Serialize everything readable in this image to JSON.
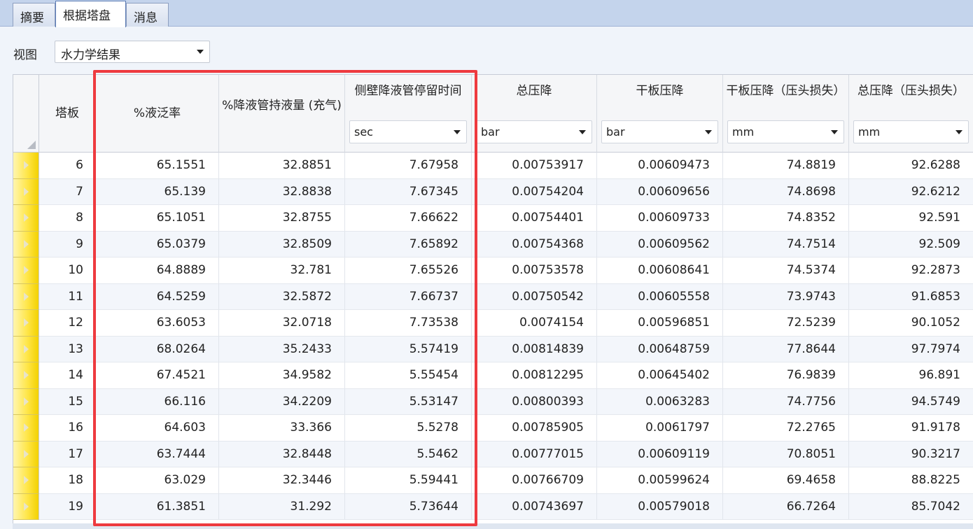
{
  "tabs": [
    {
      "label": "摘要",
      "active": false
    },
    {
      "label": "根据塔盘",
      "active": true
    },
    {
      "label": "消息",
      "active": false
    }
  ],
  "view": {
    "label": "视图",
    "selected": "水力学结果"
  },
  "colors": {
    "highlight": "#ee3a3f",
    "row_header": "#ffe64a",
    "tab_bar": "#c4d4ec"
  },
  "columns": [
    {
      "title": "塔板",
      "unit": null
    },
    {
      "title": "%液泛率",
      "unit": null
    },
    {
      "title": "%降液管持液量 (充气)",
      "unit": null
    },
    {
      "title": "侧壁降液管停留时间",
      "unit": "sec"
    },
    {
      "title": "总压降",
      "unit": "bar"
    },
    {
      "title": "干板压降",
      "unit": "bar"
    },
    {
      "title": "干板压降（压头损失）",
      "unit": "mm"
    },
    {
      "title": "总压降（压头损失）",
      "unit": "mm"
    }
  ],
  "rows": [
    [
      "6",
      "65.1551",
      "32.8851",
      "7.67958",
      "0.00753917",
      "0.00609473",
      "74.8819",
      "92.6288"
    ],
    [
      "7",
      "65.139",
      "32.8838",
      "7.67345",
      "0.00754204",
      "0.00609656",
      "74.8698",
      "92.6212"
    ],
    [
      "8",
      "65.1051",
      "32.8755",
      "7.66622",
      "0.00754401",
      "0.00609733",
      "74.8352",
      "92.591"
    ],
    [
      "9",
      "65.0379",
      "32.8509",
      "7.65892",
      "0.00754368",
      "0.00609562",
      "74.7514",
      "92.509"
    ],
    [
      "10",
      "64.8889",
      "32.781",
      "7.65526",
      "0.00753578",
      "0.00608641",
      "74.5374",
      "92.2873"
    ],
    [
      "11",
      "64.5259",
      "32.5872",
      "7.66737",
      "0.00750542",
      "0.00605558",
      "73.9743",
      "91.6853"
    ],
    [
      "12",
      "63.6053",
      "32.0718",
      "7.73538",
      "0.0074154",
      "0.00596851",
      "72.5239",
      "90.1052"
    ],
    [
      "13",
      "68.0264",
      "35.2433",
      "5.57419",
      "0.00814839",
      "0.00648759",
      "77.8644",
      "97.7974"
    ],
    [
      "14",
      "67.4521",
      "34.9582",
      "5.55454",
      "0.00812295",
      "0.00645402",
      "76.9839",
      "96.891"
    ],
    [
      "15",
      "66.116",
      "34.2209",
      "5.53147",
      "0.00800393",
      "0.0063283",
      "74.7756",
      "94.5749"
    ],
    [
      "16",
      "64.603",
      "33.366",
      "5.5278",
      "0.00785905",
      "0.0061797",
      "72.2765",
      "91.9178"
    ],
    [
      "17",
      "63.7444",
      "32.8448",
      "5.5462",
      "0.00777015",
      "0.00609119",
      "70.8051",
      "90.3217"
    ],
    [
      "18",
      "63.029",
      "32.3446",
      "5.59441",
      "0.00766709",
      "0.00599624",
      "69.4658",
      "88.8225"
    ],
    [
      "19",
      "61.3851",
      "31.292",
      "5.73644",
      "0.00743697",
      "0.00579018",
      "66.7264",
      "85.7042"
    ]
  ]
}
